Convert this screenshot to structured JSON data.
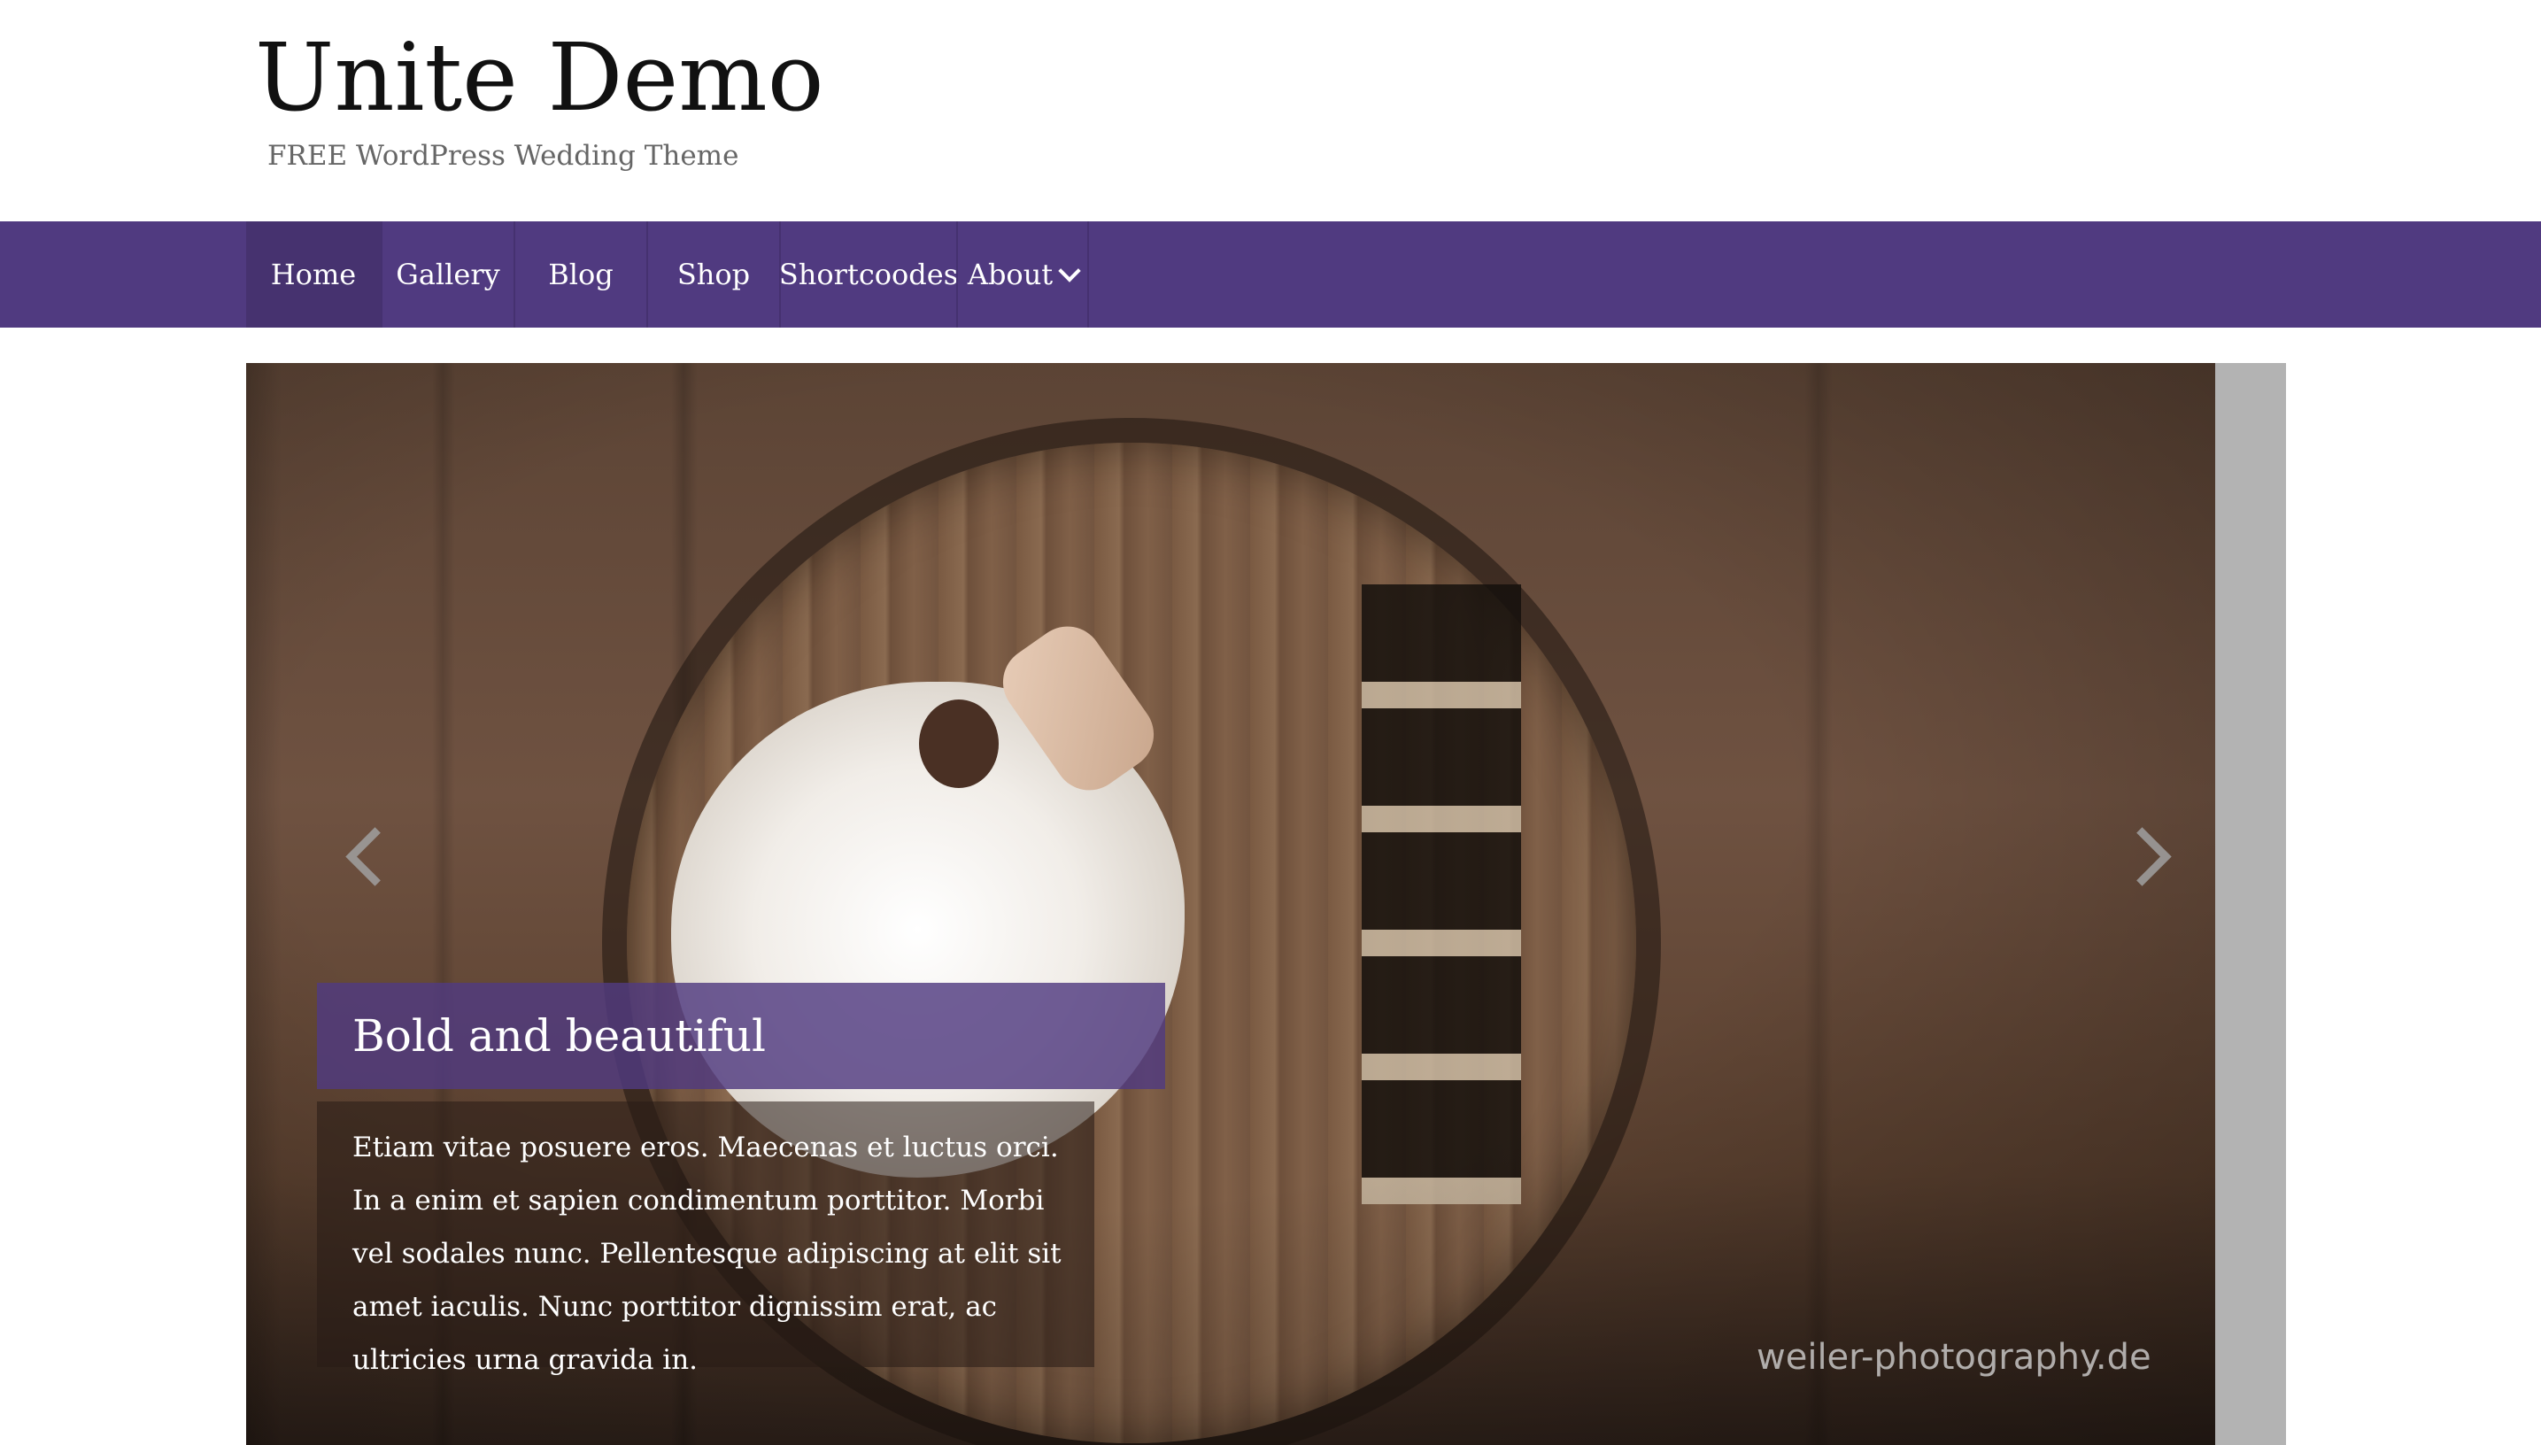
{
  "site": {
    "title": "Unite Demo",
    "tagline": "FREE WordPress Wedding Theme"
  },
  "nav": {
    "items": [
      {
        "label": "Home",
        "active": true
      },
      {
        "label": "Gallery",
        "active": false
      },
      {
        "label": "Blog",
        "active": false
      },
      {
        "label": "Shop",
        "active": false
      },
      {
        "label": "Shortcoodes",
        "active": false
      },
      {
        "label": "About",
        "active": false,
        "has_dropdown": true
      }
    ]
  },
  "slider": {
    "caption_title": "Bold and beautiful",
    "caption_text": "Etiam vitae posuere eros. Maecenas et luctus orci. In a enim et sapien condimentum porttitor. Morbi vel sodales nunc. Pellentesque adipiscing at elit sit amet iaculis. Nunc porttitor dignissim erat, ac ultricies urna gravida in.",
    "watermark": "weiler-photography.de",
    "prev_icon": "chevron-left-icon",
    "next_icon": "chevron-right-icon"
  },
  "colors": {
    "accent": "#503a80",
    "nav_active": "#46326f",
    "title_text": "#111111",
    "tagline_text": "#666666"
  }
}
